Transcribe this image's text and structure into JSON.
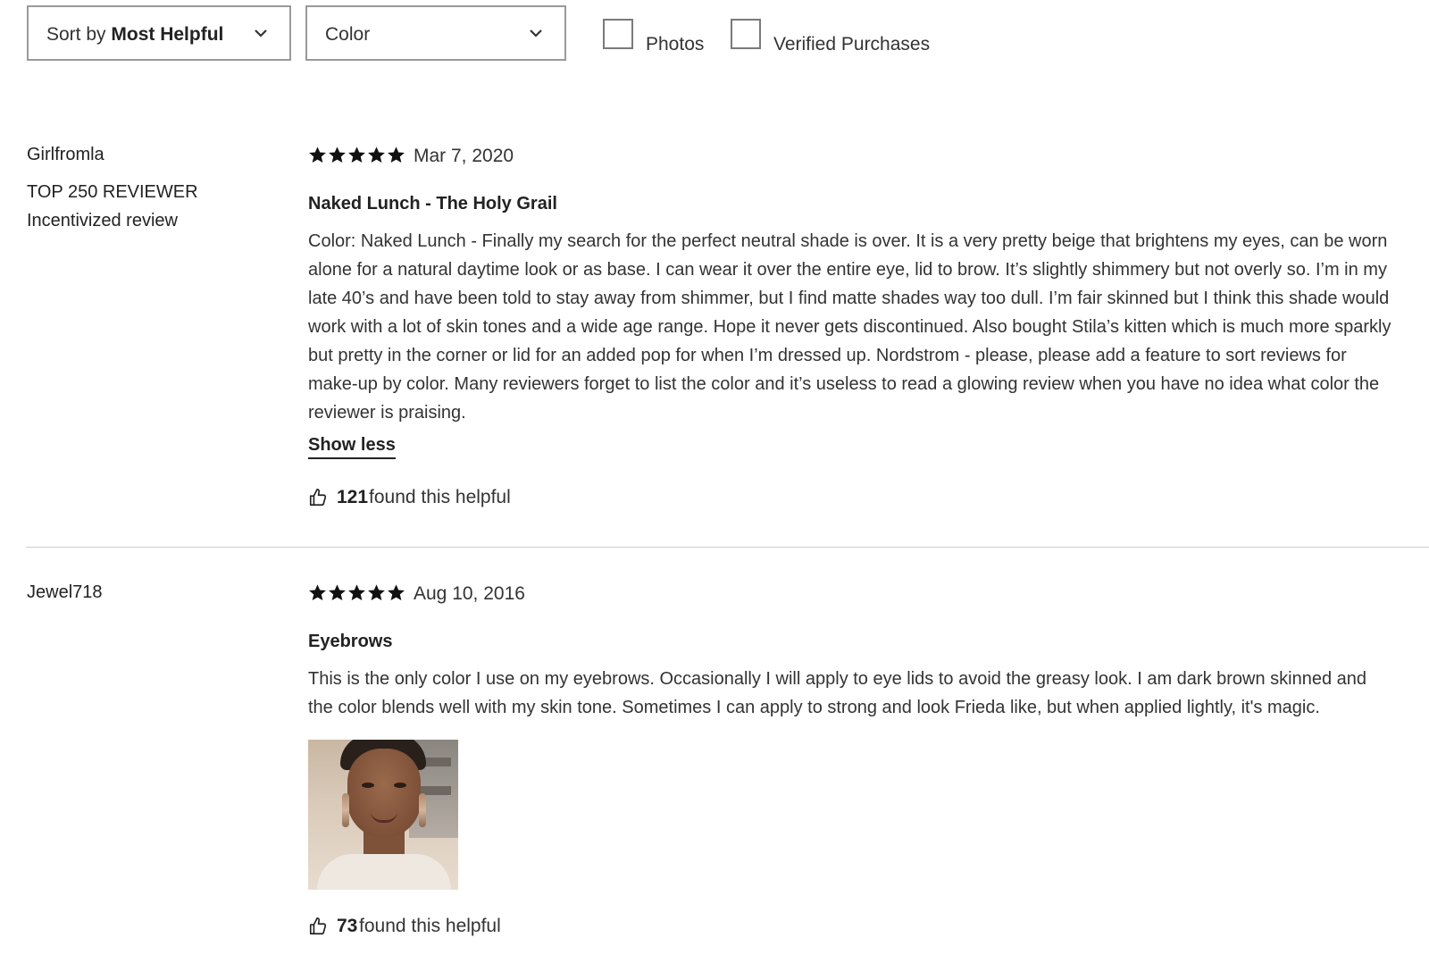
{
  "filters": {
    "sort": {
      "prefix": "Sort by ",
      "value": "Most Helpful"
    },
    "color": {
      "label": "Color"
    },
    "checkboxes": [
      {
        "label": "Photos",
        "checked": false
      },
      {
        "label": "Verified Purchases",
        "checked": false
      }
    ]
  },
  "reviews": [
    {
      "reviewer": "Girlfromla",
      "badge": "TOP 250 REVIEWER",
      "note": "Incentivized review",
      "rating": 5,
      "date": "Mar 7, 2020",
      "title": "Naked Lunch - The Holy Grail",
      "text": "Color: Naked Lunch - Finally my search for the perfect neutral shade is over. It is a very pretty beige that brightens my eyes, can be worn alone for a natural daytime look or as base. I can wear it over the entire eye, lid to brow. It’s slightly shimmery but not overly so. I’m in my late 40’s and have been told to stay away from shimmer, but I find matte shades way too dull. I’m fair skinned but I think this shade would work with a lot of skin tones and a wide age range. Hope it never gets discontinued. Also bought Stila’s kitten which is much more sparkly but pretty in the corner or lid for an added pop for when I’m dressed up. Nordstrom - please, please add a feature to sort reviews for make-up by color. Many reviewers forget to list the color and it’s useless to read a glowing review when you have no idea what color the reviewer is praising.",
      "toggle": "Show less",
      "helpful_count": "121",
      "helpful_suffix": "found this helpful"
    },
    {
      "reviewer": "Jewel718",
      "rating": 5,
      "date": "Aug 10, 2016",
      "title": "Eyebrows",
      "text": "This is the only color I use on my eyebrows. Occasionally I will apply to eye lids to avoid the greasy look. I am dark brown skinned and the color blends well with my skin tone. Sometimes I can apply to strong and look Frieda like, but when applied lightly, it's magic.",
      "helpful_count": "73",
      "helpful_suffix": "found this helpful"
    }
  ],
  "icons": {
    "chevron": "chevron-down-icon",
    "star": "star-icon",
    "thumb": "thumbs-up-icon"
  },
  "colors": {
    "text": "#222222",
    "border": "#9a9a9a",
    "divider": "#cfcfcf"
  }
}
